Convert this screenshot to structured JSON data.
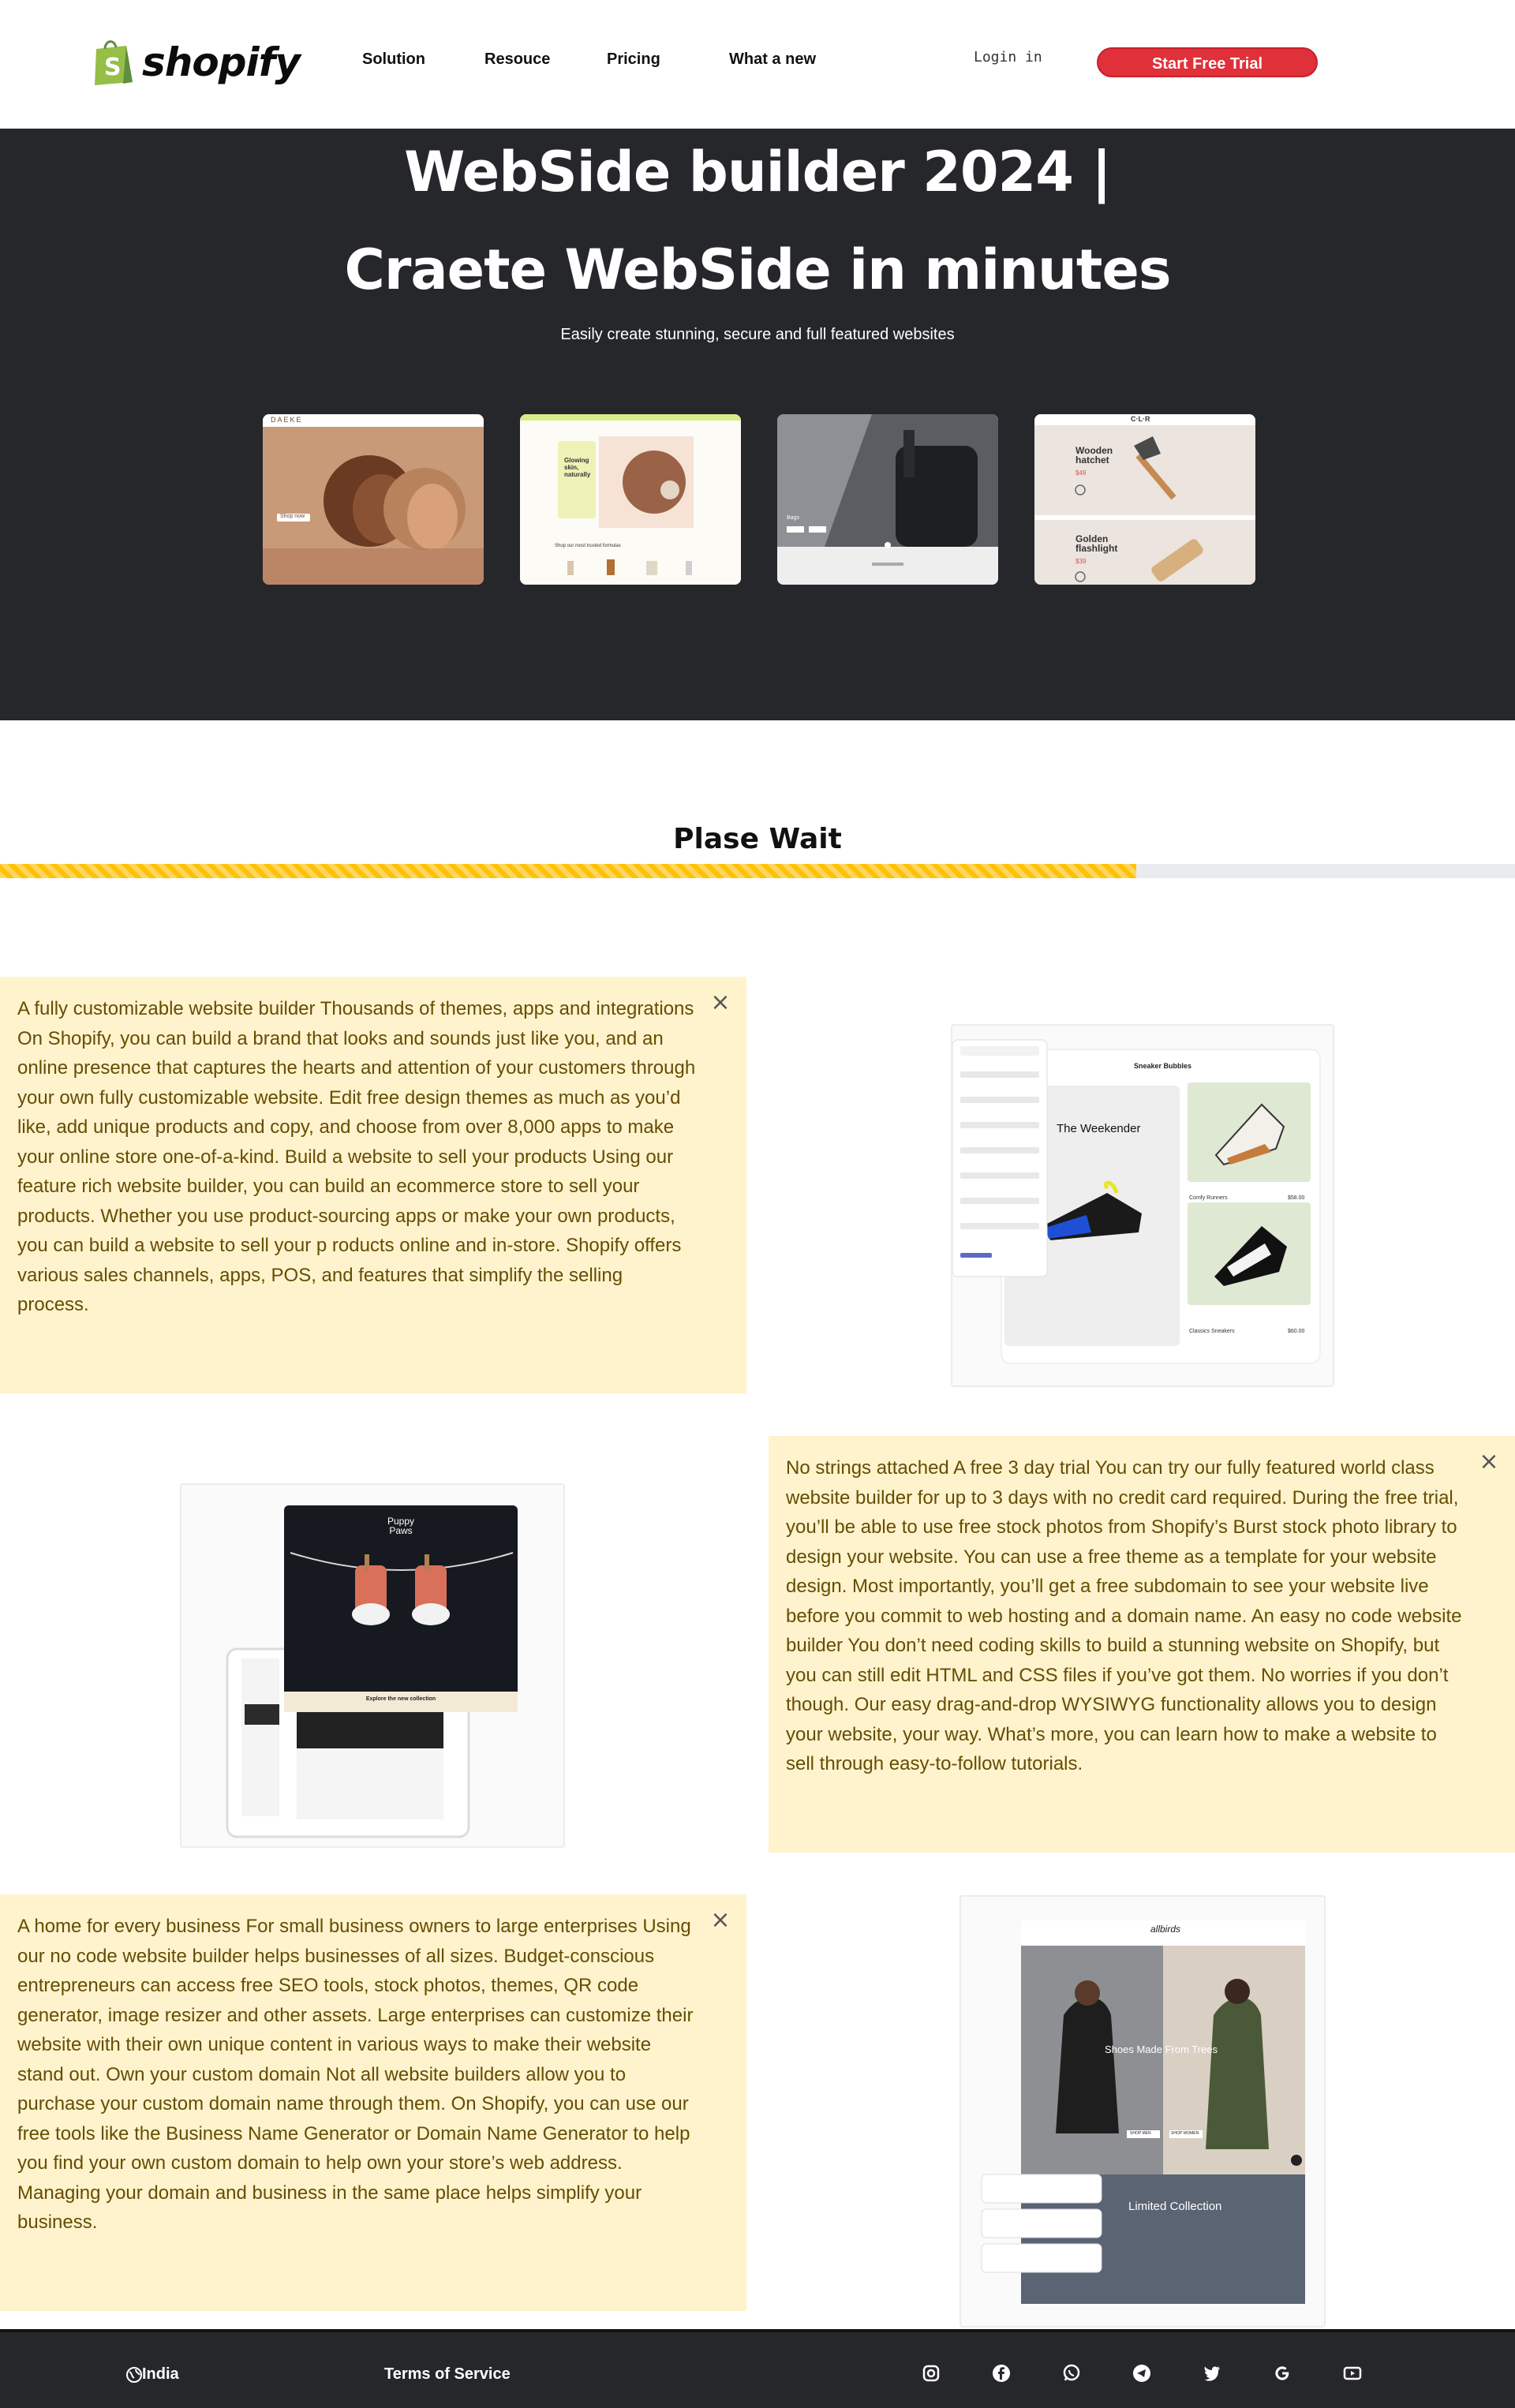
{
  "nav": {
    "brand": "shopify",
    "links": [
      "Solution",
      "Resouce",
      "Pricing",
      "What a new"
    ],
    "login": "Login in",
    "cta": "Start Free Trial"
  },
  "hero": {
    "title_line1": "WebSide builder 2024 |",
    "title_line2": "Craete WebSide in minutes",
    "subtitle": "Easily create stunning, secure and full featured websites",
    "thumbs": [
      {
        "brand": "DAEKE",
        "button": "Shop now"
      },
      {
        "heading": "Glowing skin, naturally",
        "section": "Shop our most trusted formulas"
      },
      {
        "label": "Bags"
      },
      {
        "brand": "C·L·R",
        "items": [
          {
            "name": "Wooden hatchet",
            "price": "$49"
          },
          {
            "name": "Golden flashlight",
            "price": "$39"
          }
        ]
      }
    ]
  },
  "progress": {
    "title": "Plase Wait",
    "value": 0.75
  },
  "features": [
    {
      "text": "A fully customizable website builder Thousands of themes, apps and integrations On Shopify, you can build a brand that looks and sounds just like you, and an online presence that captures the hearts and attention of your customers through your own fully customizable website. Edit free design themes as much as you’d like, add unique products and copy, and choose from over 8,000 apps to make your online store one-of-a-kind. Build a website to sell your products Using our feature rich website builder, you can build an ecommerce store to sell your products. Whether you use product-sourcing apps or make your own products, you can build a website to sell your p roducts online and in-store. Shopify offers various sales channels, apps, POS, and features that simplify the selling process."
    },
    {
      "text": "No strings attached A free 3 day trial You can try our fully featured world class website builder for up to 3 days with no credit card required. During the free trial, you’ll be able to use free stock photos from Shopify’s Burst stock photo library to design your website. You can use a free theme as a template for your website design. Most importantly, you’ll get a free subdomain to see your website live before you commit to web hosting and a domain name. An easy no code website builder You don’t need coding skills to build a stunning website on Shopify, but you can still edit HTML and CSS files if you’ve got them. No worries if you don’t though. Our easy drag-and-drop WYSIWYG functionality allows you to design your website, your way. What’s more, you can learn how to make a website to sell through easy-to-follow tutorials."
    },
    {
      "text": "A home for every business For small business owners to large enterprises Using our no code website builder helps businesses of all sizes. Budget-conscious entrepreneurs can access free SEO tools, stock photos, themes, QR code generator, image resizer and other assets. Large enterprises can customize their website with their own unique content in various ways to make their website stand out. Own your custom domain Not all website builders allow you to purchase your custom domain name through them. On Shopify, you can use our free tools like the Business Name Generator or Domain Name Generator to help you find your own custom domain to help own your store’s web address. Managing your domain and business in the same place helps simplify your business."
    }
  ],
  "shots": {
    "sneaker": {
      "store": "Sneaker Bubbles",
      "product": "The Weekender",
      "item1": "Comfy Runners",
      "price1": "$58.00",
      "item2": "Classics Sneakers",
      "price2": "$60.00"
    },
    "puppy": {
      "brand": "Puppy Paws",
      "cta": "Explore the new collection"
    },
    "fashion": {
      "brand": "allbirds",
      "hero": "Shoes Made From Trees",
      "card": "Limited Collection",
      "btn1": "SHOP MEN",
      "btn2": "SHOP WOMEN"
    }
  },
  "footer": {
    "region": "India",
    "terms": "Terms of Service",
    "socials": [
      "instagram-icon",
      "facebook-icon",
      "whatsapp-icon",
      "telegram-icon",
      "twitter-icon",
      "google-icon",
      "youtube-icon"
    ]
  },
  "colors": {
    "accent": "#e0303a",
    "hero_bg": "#25272b",
    "progress": "#ffc107",
    "alert_bg": "#fff3cd",
    "alert_text": "#664d03"
  }
}
